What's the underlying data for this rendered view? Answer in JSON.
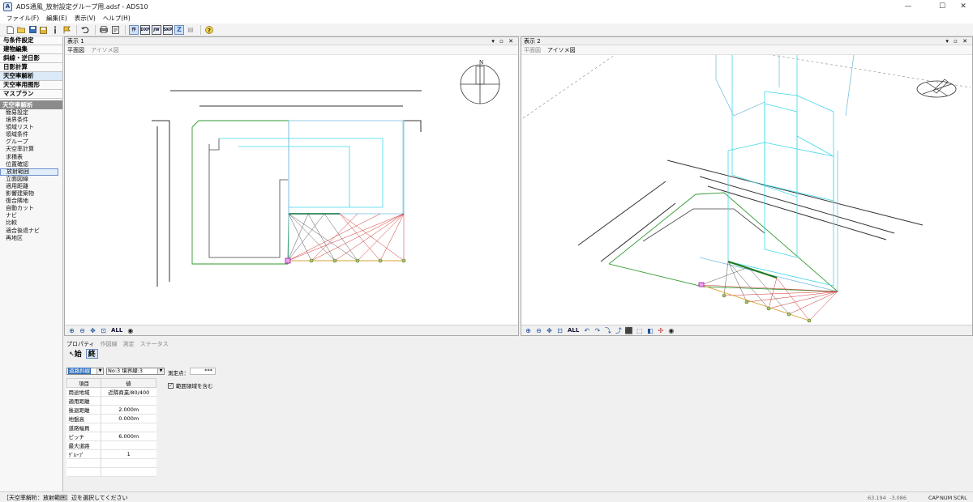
{
  "window": {
    "title": "ADS通風_放射設定グループ用.adsf - ADS10",
    "app_icon": "A",
    "minimize": "—",
    "maximize": "☐",
    "close": "✕"
  },
  "menu": [
    "ファイル(F)",
    "編集(E)",
    "表示(V)",
    "ヘルプ(H)"
  ],
  "toolbar": {
    "icons": [
      "new-icon",
      "open-icon",
      "save-icon",
      "save-as-icon",
      "info-icon",
      "flag-icon",
      "undo-icon",
      "print-icon",
      "preview-icon"
    ],
    "boxes": [
      "作",
      "DXF",
      "JW",
      "SKP",
      "Z",
      "▤"
    ],
    "help": "?"
  },
  "sidebar": {
    "heads": [
      "与条件設定",
      "建物編集",
      "斜線・逆日影",
      "日影計算",
      "天空率解析",
      "天空率用图形",
      "マスプラン"
    ],
    "active_head_index": 4,
    "section": "天空率解析",
    "items": [
      "簡易設定",
      "境界条件",
      "領域リスト",
      "領域条件",
      "グループ",
      "天空率計算",
      "求積表",
      "位置確認",
      "放射範囲",
      "立面図線",
      "適用距離",
      "影響建築物",
      "復合隣地",
      "自動カット",
      "ナビ",
      "比較",
      "適合後退ナビ",
      "再地区"
    ],
    "selected_item_index": 8
  },
  "pane1": {
    "title": "表示 1",
    "controls": "▾ ▫ ✕",
    "tabs": [
      "平面図",
      "アイソメ図"
    ],
    "active_tab": 0,
    "all_label": "ALL"
  },
  "pane2": {
    "title": "表示 2",
    "controls": "▾ ▫ ✕",
    "tabs": [
      "平面図",
      "アイソメ図"
    ],
    "active_tab": 1,
    "all_label": "ALL"
  },
  "compass": {
    "north": "N"
  },
  "properties": {
    "tabs": [
      "プロパティ",
      "作図線",
      "測定",
      "ステータス"
    ],
    "active_tab": 0,
    "start_button": "始",
    "end_button": "終",
    "type_select": "道路斜線",
    "no_select": "No:3 境界線:3",
    "measure_label": "測定点：",
    "measure_value": "***",
    "checkbox_label": "範囲領域を含む",
    "checkbox_checked": "✓",
    "grid_headers": [
      "項目",
      "値"
    ],
    "grid_rows": [
      [
        "用途地域",
        "近隣商業/80/400"
      ],
      [
        "適用距離",
        ""
      ],
      [
        "後退距離",
        "2.000m"
      ],
      [
        "地盤高",
        "0.000m"
      ],
      [
        "道路幅員",
        ""
      ],
      [
        "ピッチ",
        "6.000m"
      ],
      [
        "最大道路",
        ""
      ],
      [
        "ｸﾞﾙｰﾌﾟ",
        "1"
      ],
      [
        "",
        ""
      ],
      [
        "",
        ""
      ]
    ]
  },
  "status": {
    "message": "［天空率解析：放射範囲］辺を選択してください",
    "x": "63.194",
    "y": "-3.086",
    "keys": [
      "CAP",
      "NUM",
      "SCRL"
    ]
  }
}
